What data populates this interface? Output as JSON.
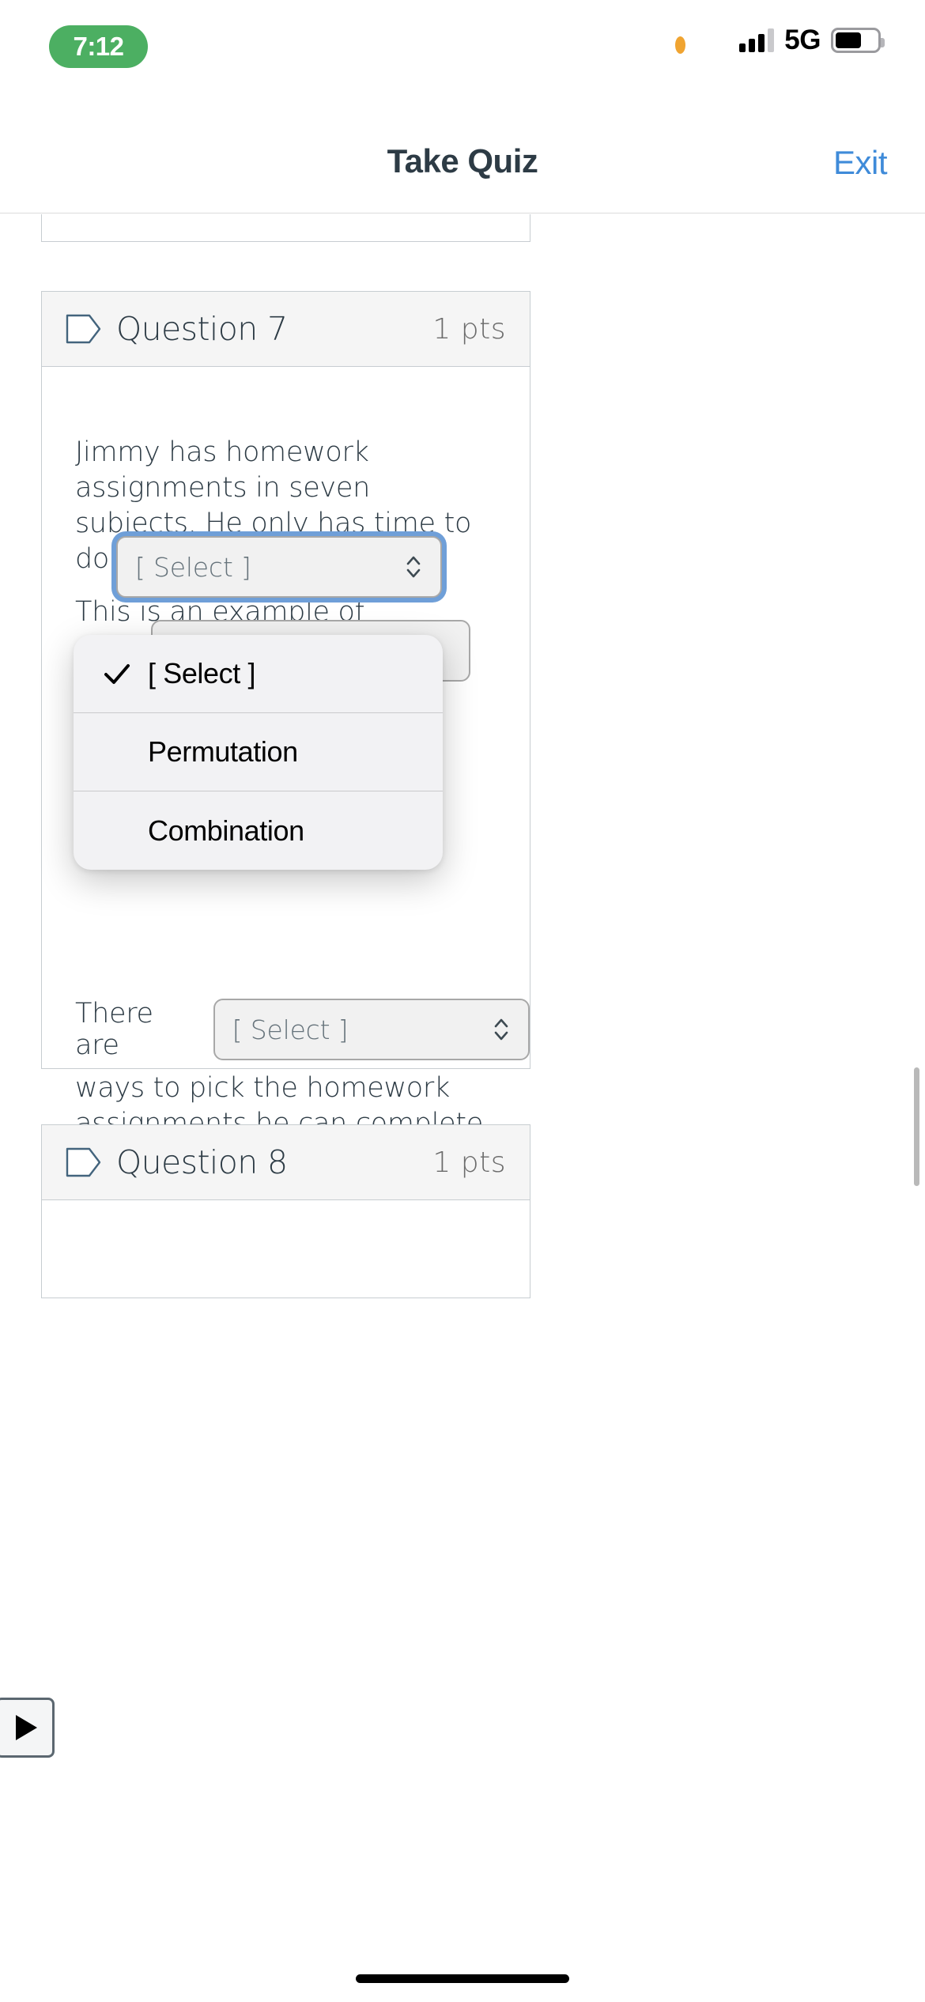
{
  "status_bar": {
    "time": "7:12",
    "network": "5G",
    "icons": {
      "privacy": "orange-privacy-dot",
      "signal": "cellular-signal-icon",
      "battery": "battery-icon"
    }
  },
  "nav": {
    "title": "Take Quiz",
    "exit_label": "Exit"
  },
  "questions": [
    {
      "label": "Question 7",
      "points": "1 pts",
      "paragraph": "Jimmy has homework assignments in seven subjects.  He only has time to do four of them.",
      "prompt_line": "This is an example of",
      "select_one_value": "[ Select ]",
      "there_are_lead": "There are",
      "select_two_value": "[ Select ]",
      "tail": "ways to pick the homework assignments he can complete."
    },
    {
      "label": "Question 8",
      "points": "1 pts"
    }
  ],
  "dropdown": {
    "visible": true,
    "options": [
      {
        "label": "[ Select ]",
        "checked": true
      },
      {
        "label": "Permutation",
        "checked": false
      },
      {
        "label": "Combination",
        "checked": false
      }
    ]
  },
  "controls": {
    "speak_button": "play-icon"
  },
  "colors": {
    "accent_link": "#3f8bd9",
    "focus_ring": "#6f9fd8",
    "title_text": "#2d3b45",
    "status_pill": "#4caf62",
    "card_border": "#c7cdd1",
    "header_bg": "#f5f5f5"
  }
}
